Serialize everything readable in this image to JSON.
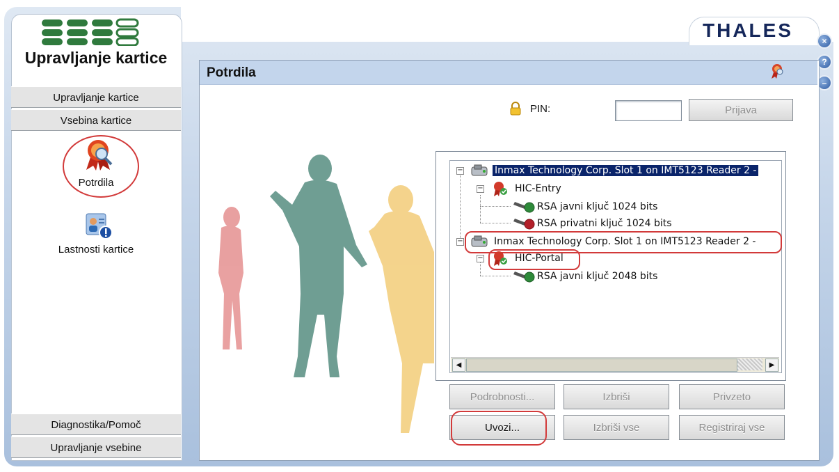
{
  "app": {
    "title": "Upravljanje kartice",
    "brand": "THALES"
  },
  "window_buttons": [
    {
      "icon": "close-icon",
      "glyph": "×"
    },
    {
      "icon": "help-icon",
      "glyph": "?"
    },
    {
      "icon": "minimize-icon",
      "glyph": "–"
    }
  ],
  "sidebar": {
    "top_items": [
      "Upravljanje kartice",
      "Vsebina kartice"
    ],
    "links": [
      {
        "label": "Potrdila",
        "icon": "certificate-icon"
      },
      {
        "label": "Lastnosti kartice",
        "icon": "card-properties-icon"
      }
    ],
    "bottom_items": [
      "Diagnostika/Pomoč",
      "Upravljanje vsebine"
    ]
  },
  "main": {
    "title": "Potrdila",
    "pin_label": "PIN:",
    "pin_value": "",
    "login_button": "Prijava",
    "tree": [
      {
        "text": "Inmax Technology Corp. Slot 1 on IMT5123 Reader 2 -",
        "level": 0,
        "selected": true,
        "icon": "card-reader-icon"
      },
      {
        "text": "HIC-Entry",
        "level": 1,
        "selected": false,
        "icon": "certificate-icon"
      },
      {
        "text": "RSA javni ključ 1024 bits",
        "level": 2,
        "selected": false,
        "icon": "public-key-icon"
      },
      {
        "text": "RSA privatni ključ 1024 bits",
        "level": 2,
        "selected": false,
        "icon": "private-key-icon"
      },
      {
        "text": "Inmax Technology Corp. Slot 1 on IMT5123 Reader 2 -",
        "level": 0,
        "selected": false,
        "icon": "card-reader-icon"
      },
      {
        "text": "HIC-Portal",
        "level": 1,
        "selected": false,
        "icon": "certificate-icon"
      },
      {
        "text": "RSA javni ključ 2048 bits",
        "level": 2,
        "selected": false,
        "icon": "public-key-icon"
      }
    ],
    "buttons_row1": [
      "Podrobnosti...",
      "Izbriši",
      "Privzeto"
    ],
    "buttons_row2": [
      "Uvozi...",
      "Izbriši vse",
      "Registriraj vse"
    ]
  },
  "colors": {
    "selection": "#0a246a",
    "annotation": "#d23a3a",
    "header": "#c3d5ec",
    "brand": "#15275a"
  }
}
